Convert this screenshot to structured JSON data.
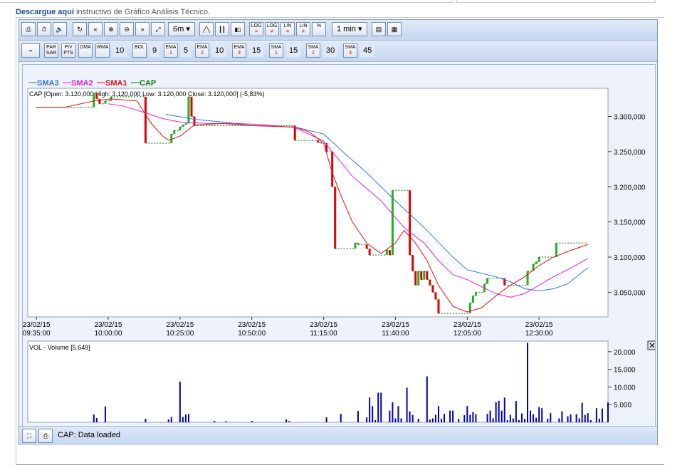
{
  "header": {
    "link_text": "Descargue aquí",
    "rest_text": " instructivo de Gráfico Análisis Técnico."
  },
  "toolbar1": {
    "period_label": "6m",
    "interval_label": "1 min",
    "buttons": [
      {
        "name": "print-icon",
        "glyph": "⎙"
      },
      {
        "name": "clock-icon",
        "glyph": "⏱"
      },
      {
        "name": "sound-icon",
        "glyph": "🔈"
      },
      {
        "name": "refresh-icon",
        "glyph": "↻"
      },
      {
        "name": "rewind-icon",
        "glyph": "«"
      },
      {
        "name": "zoom-in-icon",
        "glyph": "⊕"
      },
      {
        "name": "zoom-out-icon",
        "glyph": "⊖"
      },
      {
        "name": "forward-icon",
        "glyph": "»"
      },
      {
        "name": "zoom-fit-icon",
        "glyph": "⤢"
      }
    ],
    "chart_types": [
      {
        "name": "line-chart-icon",
        "glyph": "╱╲"
      },
      {
        "name": "bar-chart-icon",
        "glyph": "┃┃"
      },
      {
        "name": "candle-chart-icon",
        "glyph": "▮▯"
      }
    ],
    "scale_buttons": [
      {
        "name": "log-equal-button",
        "top": "LOG",
        "bot": "="
      },
      {
        "name": "log-not-equal-button",
        "top": "LOG",
        "bot": "≠"
      },
      {
        "name": "lin-equal-button",
        "top": "LIN",
        "bot": "="
      },
      {
        "name": "lin-not-equal-button",
        "top": "LIN",
        "bot": "≠"
      },
      {
        "name": "percent-button",
        "top": "%",
        "bot": ""
      }
    ]
  },
  "toolbar2": {
    "items": [
      {
        "kind": "btn",
        "name": "indicator-add-button",
        "label": "+"
      },
      {
        "kind": "btn",
        "name": "par-sar-button",
        "label": "PAR SAR"
      },
      {
        "kind": "btn",
        "name": "piv-pts-button",
        "label": "PIV PTS"
      },
      {
        "kind": "btn",
        "name": "dma-button",
        "label": "DMA"
      },
      {
        "kind": "btn",
        "name": "wma-button",
        "label": "WMA"
      },
      {
        "kind": "val",
        "name": "wma-period",
        "label": "10"
      },
      {
        "kind": "btn",
        "name": "bol-button",
        "label": "BOL"
      },
      {
        "kind": "val",
        "name": "bol-period",
        "label": "9"
      },
      {
        "kind": "btn",
        "name": "ema1-button",
        "label": "EMA",
        "sub": "1"
      },
      {
        "kind": "val",
        "name": "ema1-period",
        "label": "5"
      },
      {
        "kind": "btn",
        "name": "ema2-button",
        "label": "EMA",
        "sub": "2"
      },
      {
        "kind": "val",
        "name": "ema2-period",
        "label": "10"
      },
      {
        "kind": "btn",
        "name": "ema3-button",
        "label": "EMA",
        "sub": "3"
      },
      {
        "kind": "val",
        "name": "ema3-period",
        "label": "15"
      },
      {
        "kind": "btn",
        "name": "sma1-button",
        "label": "SMA",
        "sub": "1"
      },
      {
        "kind": "val",
        "name": "sma1-period",
        "label": "15"
      },
      {
        "kind": "btn",
        "name": "sma2-button",
        "label": "SMA",
        "sub": "2"
      },
      {
        "kind": "val",
        "name": "sma2-period",
        "label": "30"
      },
      {
        "kind": "btn",
        "name": "sma3-button",
        "label": "SMA",
        "sub": "3"
      },
      {
        "kind": "val",
        "name": "sma3-period",
        "label": "45"
      }
    ]
  },
  "status": {
    "text": "CAP: Data loaded"
  },
  "chart_data": [
    {
      "type": "line",
      "legend": [
        {
          "name": "SMA3",
          "color": "#3a6fd8"
        },
        {
          "name": "SMA2",
          "color": "#e020e0"
        },
        {
          "name": "SMA1",
          "color": "#e01010"
        },
        {
          "name": "CAP",
          "color": "#008000"
        }
      ],
      "info_label": "CAP [Open: 3.120,000   High: 3.120,000   Low: 3.120,000   Close: 3.120,000] (-5,83%)",
      "x_ticks": [
        {
          "t": 0,
          "date": "23/02/15",
          "time": "09:35:00"
        },
        {
          "t": 25,
          "date": "23/02/15",
          "time": "10:00:00"
        },
        {
          "t": 50,
          "date": "23/02/15",
          "time": "10:25:00"
        },
        {
          "t": 75,
          "date": "23/02/15",
          "time": "10:50:00"
        },
        {
          "t": 100,
          "date": "23/02/15",
          "time": "11:15:00"
        },
        {
          "t": 125,
          "date": "23/02/15",
          "time": "11:40:00"
        },
        {
          "t": 150,
          "date": "23/02/15",
          "time": "12:05:00"
        },
        {
          "t": 175,
          "date": "23/02/15",
          "time": "12:30:00"
        }
      ],
      "y_ticks": [
        "3.300,000",
        "3.250,000",
        "3.200,000",
        "3.150,000",
        "3.100,000",
        "3.050,000"
      ],
      "y_tick_values": [
        3300,
        3250,
        3200,
        3150,
        3100,
        3050
      ],
      "ylim": [
        3015,
        3340
      ],
      "xlim": [
        -3,
        199
      ],
      "price": [
        [
          0,
          3313
        ],
        [
          10,
          3313
        ],
        [
          19,
          3313
        ],
        [
          20,
          3333
        ],
        [
          21,
          3325
        ],
        [
          22,
          3318
        ],
        [
          23,
          3318
        ],
        [
          24,
          3322
        ],
        [
          26,
          3328
        ],
        [
          37,
          3328
        ],
        [
          38,
          3262
        ],
        [
          46,
          3262
        ],
        [
          47,
          3275
        ],
        [
          48,
          3280
        ],
        [
          49,
          3280
        ],
        [
          50,
          3285
        ],
        [
          51,
          3288
        ],
        [
          52,
          3290
        ],
        [
          53,
          3328
        ],
        [
          54,
          3300
        ],
        [
          55,
          3287
        ],
        [
          65,
          3287
        ],
        [
          74,
          3287
        ],
        [
          89,
          3287
        ],
        [
          90,
          3266
        ],
        [
          97,
          3266
        ],
        [
          98,
          3263
        ],
        [
          99,
          3262
        ],
        [
          100,
          3262
        ],
        [
          101,
          3250
        ],
        [
          102,
          3250
        ],
        [
          103,
          3200
        ],
        [
          104,
          3112
        ],
        [
          110,
          3112
        ],
        [
          111,
          3120
        ],
        [
          112,
          3118
        ],
        [
          114,
          3118
        ],
        [
          115,
          3112
        ],
        [
          116,
          3103
        ],
        [
          121,
          3103
        ],
        [
          122,
          3110
        ],
        [
          123,
          3103
        ],
        [
          124,
          3195
        ],
        [
          129,
          3195
        ],
        [
          130,
          3103
        ],
        [
          131,
          3080
        ],
        [
          132,
          3060
        ],
        [
          133,
          3080
        ],
        [
          134,
          3068
        ],
        [
          135,
          3080
        ],
        [
          136,
          3068
        ],
        [
          137,
          3060
        ],
        [
          138,
          3050
        ],
        [
          139,
          3040
        ],
        [
          140,
          3020
        ],
        [
          150,
          3020
        ],
        [
          151,
          3035
        ],
        [
          152,
          3045
        ],
        [
          153,
          3050
        ],
        [
          155,
          3050
        ],
        [
          156,
          3062
        ],
        [
          157,
          3070
        ],
        [
          162,
          3070
        ],
        [
          163,
          3060
        ],
        [
          170,
          3060
        ],
        [
          171,
          3080
        ],
        [
          173,
          3090
        ],
        [
          174,
          3093
        ],
        [
          175,
          3100
        ],
        [
          180,
          3100
        ],
        [
          181,
          3120
        ],
        [
          192,
          3120
        ]
      ],
      "sma1": [
        [
          0,
          3313
        ],
        [
          10,
          3313
        ],
        [
          20,
          3322
        ],
        [
          26,
          3325
        ],
        [
          35,
          3322
        ],
        [
          40,
          3290
        ],
        [
          44,
          3272
        ],
        [
          46,
          3266
        ],
        [
          50,
          3272
        ],
        [
          55,
          3288
        ],
        [
          65,
          3290
        ],
        [
          75,
          3287
        ],
        [
          90,
          3285
        ],
        [
          95,
          3278
        ],
        [
          100,
          3262
        ],
        [
          103,
          3220
        ],
        [
          106,
          3188
        ],
        [
          110,
          3150
        ],
        [
          115,
          3120
        ],
        [
          120,
          3105
        ],
        [
          125,
          3120
        ],
        [
          128,
          3138
        ],
        [
          132,
          3120
        ],
        [
          136,
          3095
        ],
        [
          140,
          3060
        ],
        [
          145,
          3030
        ],
        [
          150,
          3022
        ],
        [
          155,
          3028
        ],
        [
          160,
          3045
        ],
        [
          165,
          3060
        ],
        [
          170,
          3072
        ],
        [
          175,
          3088
        ],
        [
          180,
          3100
        ],
        [
          185,
          3108
        ],
        [
          192,
          3118
        ]
      ],
      "sma2": [
        [
          25,
          3318
        ],
        [
          30,
          3315
        ],
        [
          38,
          3305
        ],
        [
          44,
          3297
        ],
        [
          50,
          3292
        ],
        [
          60,
          3290
        ],
        [
          70,
          3290
        ],
        [
          80,
          3288
        ],
        [
          90,
          3284
        ],
        [
          100,
          3265
        ],
        [
          110,
          3215
        ],
        [
          120,
          3180
        ],
        [
          128,
          3142
        ],
        [
          135,
          3120
        ],
        [
          140,
          3095
        ],
        [
          145,
          3075
        ],
        [
          150,
          3068
        ],
        [
          155,
          3058
        ],
        [
          160,
          3048
        ],
        [
          165,
          3043
        ],
        [
          170,
          3048
        ],
        [
          175,
          3060
        ],
        [
          180,
          3072
        ],
        [
          185,
          3082
        ],
        [
          192,
          3098
        ]
      ],
      "sma3": [
        [
          45,
          3303
        ],
        [
          55,
          3296
        ],
        [
          65,
          3292
        ],
        [
          75,
          3287
        ],
        [
          90,
          3285
        ],
        [
          100,
          3275
        ],
        [
          108,
          3245
        ],
        [
          115,
          3220
        ],
        [
          125,
          3180
        ],
        [
          135,
          3142
        ],
        [
          145,
          3100
        ],
        [
          150,
          3082
        ],
        [
          160,
          3072
        ],
        [
          165,
          3065
        ],
        [
          170,
          3055
        ],
        [
          175,
          3052
        ],
        [
          180,
          3055
        ],
        [
          185,
          3062
        ],
        [
          192,
          3085
        ]
      ]
    },
    {
      "type": "bar",
      "title": "VOL - Volume [5.649]",
      "y_ticks": [
        "20.000",
        "15.000",
        "10.000",
        "5.000"
      ],
      "y_tick_values": [
        20000,
        15000,
        10000,
        5000
      ],
      "ylim": [
        0,
        23000
      ],
      "xlim": [
        -3,
        199
      ],
      "volume": [
        [
          20,
          2200
        ],
        [
          21,
          1200
        ],
        [
          24,
          4500
        ],
        [
          38,
          1000
        ],
        [
          46,
          800
        ],
        [
          47,
          1500
        ],
        [
          50,
          11500
        ],
        [
          51,
          1500
        ],
        [
          52,
          2200
        ],
        [
          53,
          2400
        ],
        [
          62,
          400
        ],
        [
          66,
          300
        ],
        [
          75,
          400
        ],
        [
          87,
          800
        ],
        [
          88,
          300
        ],
        [
          101,
          1400
        ],
        [
          106,
          2400
        ],
        [
          112,
          3200
        ],
        [
          115,
          1400
        ],
        [
          116,
          7000
        ],
        [
          117,
          4600
        ],
        [
          118,
          600
        ],
        [
          119,
          8400
        ],
        [
          120,
          8400
        ],
        [
          123,
          3300
        ],
        [
          124,
          5700
        ],
        [
          125,
          1100
        ],
        [
          126,
          4600
        ],
        [
          127,
          1100
        ],
        [
          129,
          9800
        ],
        [
          130,
          3100
        ],
        [
          131,
          2100
        ],
        [
          133,
          1000
        ],
        [
          136,
          13000
        ],
        [
          137,
          800
        ],
        [
          138,
          1100
        ],
        [
          139,
          2100
        ],
        [
          140,
          4600
        ],
        [
          141,
          1000
        ],
        [
          142,
          2400
        ],
        [
          144,
          3300
        ],
        [
          145,
          3300
        ],
        [
          147,
          1000
        ],
        [
          149,
          2000
        ],
        [
          150,
          4600
        ],
        [
          151,
          2100
        ],
        [
          152,
          2900
        ],
        [
          153,
          2300
        ],
        [
          157,
          2400
        ],
        [
          158,
          3300
        ],
        [
          159,
          1100
        ],
        [
          160,
          5700
        ],
        [
          161,
          6100
        ],
        [
          162,
          3300
        ],
        [
          163,
          7000
        ],
        [
          164,
          600
        ],
        [
          165,
          2100
        ],
        [
          166,
          1100
        ],
        [
          167,
          6000
        ],
        [
          168,
          600
        ],
        [
          169,
          2500
        ],
        [
          170,
          1000
        ],
        [
          171,
          22500
        ],
        [
          172,
          3300
        ],
        [
          173,
          2300
        ],
        [
          174,
          1300
        ],
        [
          175,
          4300
        ],
        [
          176,
          4000
        ],
        [
          178,
          1000
        ],
        [
          179,
          2600
        ],
        [
          182,
          1100
        ],
        [
          183,
          3100
        ],
        [
          185,
          1700
        ],
        [
          186,
          2200
        ],
        [
          188,
          2300
        ],
        [
          189,
          1100
        ],
        [
          190,
          5500
        ],
        [
          191,
          2100
        ],
        [
          192,
          2600
        ],
        [
          193,
          600
        ],
        [
          195,
          4000
        ],
        [
          196,
          1000
        ],
        [
          197,
          3900
        ],
        [
          199,
          5600
        ]
      ]
    }
  ]
}
